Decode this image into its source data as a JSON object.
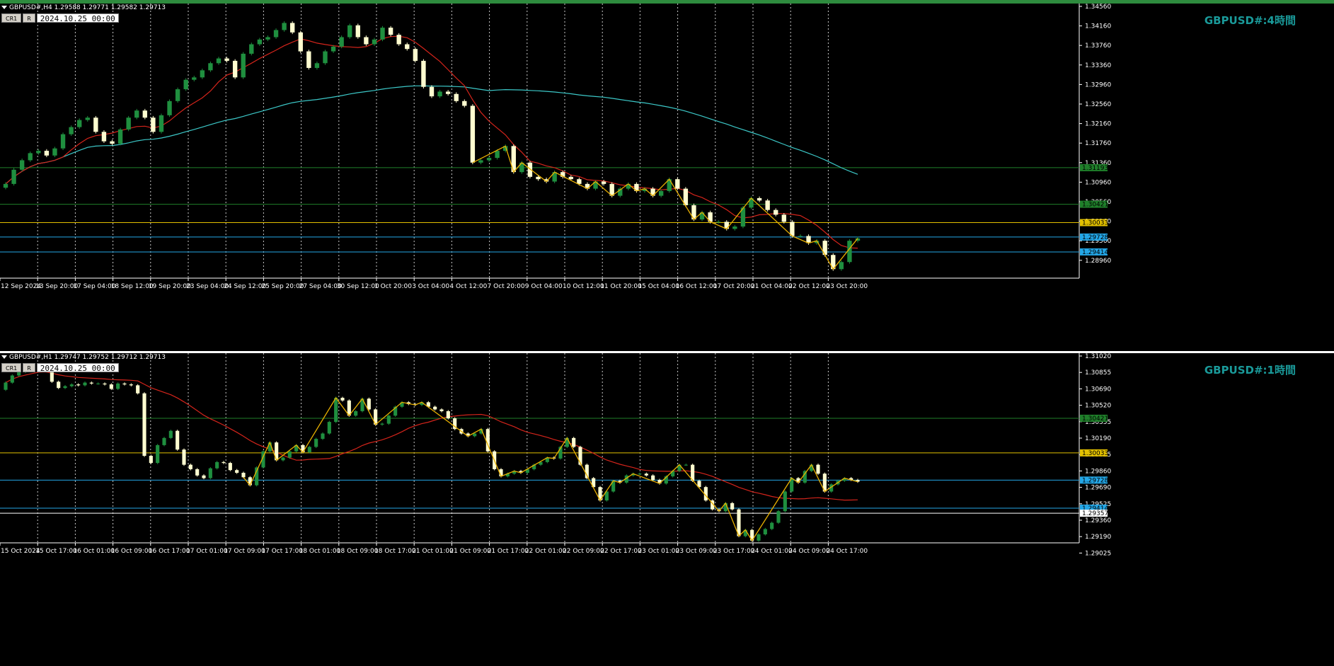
{
  "colors": {
    "background": "#000000",
    "axis": "#ffffff",
    "grid": "#c8c8c8",
    "candle_up": "#1f8f3f",
    "candle_down": "#fffdd0",
    "ma_fast": "#d4241b",
    "ma_slow": "#3cc8c8",
    "zigzag": "#e8b000",
    "line_green": "#1f7f2a",
    "line_yellow": "#e2c000",
    "line_blue": "#23a6e6",
    "symbol_label": "#1a9a9a"
  },
  "panes": [
    {
      "id": "h4",
      "header": "GBPUSD#,H4  1.29588 1.29771 1.29582 1.29713",
      "buttons": [
        "CR1",
        "R"
      ],
      "date_box": "2024.10.25 00:00",
      "symbol_label": "GBPUSD#:4時間",
      "price_ticks": [
        "1.34560",
        "1.34160",
        "1.33760",
        "1.33360",
        "1.32960",
        "1.32560",
        "1.32160",
        "1.31760",
        "1.31360",
        "1.30960",
        "1.30560",
        "1.30160",
        "1.29560",
        "1.28960"
      ],
      "time_ticks": [
        "12 Sep 2024",
        "13 Sep 20:00",
        "17 Sep 04:00",
        "18 Sep 12:00",
        "19 Sep 20:00",
        "23 Sep 04:00",
        "24 Sep 12:00",
        "25 Sep 20:00",
        "27 Sep 04:00",
        "30 Sep 12:00",
        "1 Oct 20:00",
        "3 Oct 04:00",
        "4 Oct 12:00",
        "7 Oct 20:00",
        "9 Oct 04:00",
        "10 Oct 12:00",
        "11 Oct 20:00",
        "15 Oct 04:00",
        "16 Oct 12:00",
        "17 Oct 20:00",
        "21 Oct 04:00",
        "22 Oct 12:00",
        "23 Oct 20:00"
      ],
      "price_labels": [
        {
          "value": "1.31193",
          "color": "#1f7f2a"
        },
        {
          "value": "1.30421",
          "color": "#1f7f2a"
        },
        {
          "value": "1.30033",
          "color": "#e2c000"
        },
        {
          "value": "1.29728",
          "color": "#23a6e6"
        },
        {
          "value": "1.29414",
          "color": "#23a6e6"
        }
      ]
    },
    {
      "id": "h1",
      "header": "GBPUSD#,H1  1.29747 1.29752 1.29712 1.29713",
      "buttons": [
        "CR1",
        "R"
      ],
      "date_box": "2024.10.25 00:00",
      "symbol_label": "GBPUSD#:1時間",
      "price_ticks": [
        "1.31020",
        "1.30855",
        "1.30690",
        "1.30520",
        "1.30355",
        "1.30190",
        "1.30025",
        "1.29860",
        "1.29690",
        "1.29525",
        "1.29360",
        "1.29190",
        "1.29025"
      ],
      "time_ticks": [
        "15 Oct 2024",
        "15 Oct 17:00",
        "16 Oct 01:00",
        "16 Oct 09:00",
        "16 Oct 17:00",
        "17 Oct 01:00",
        "17 Oct 09:00",
        "17 Oct 17:00",
        "18 Oct 01:00",
        "18 Oct 09:00",
        "18 Oct 17:00",
        "21 Oct 01:00",
        "21 Oct 09:00",
        "21 Oct 17:00",
        "22 Oct 01:00",
        "22 Oct 09:00",
        "22 Oct 17:00",
        "23 Oct 01:00",
        "23 Oct 09:00",
        "23 Oct 17:00",
        "24 Oct 01:00",
        "24 Oct 09:00",
        "24 Oct 17:00"
      ],
      "price_labels": [
        {
          "value": "1.30421",
          "color": "#1f7f2a"
        },
        {
          "value": "1.30033",
          "color": "#e2c000"
        },
        {
          "value": "1.29728",
          "color": "#23a6e6"
        },
        {
          "value": "1.29414",
          "color": "#23a6e6"
        },
        {
          "value": "1.29357",
          "color": "#ffffff"
        }
      ]
    }
  ],
  "chart_data": [
    {
      "type": "line",
      "title": "GBPUSD#:4時間",
      "timeframe": "H4",
      "ylim": [
        1.2886,
        1.3466
      ],
      "hlines": [
        1.31193,
        1.30421,
        1.30033,
        1.29728,
        1.29414
      ],
      "series": [
        {
          "values": [
            1.3085,
            1.3115,
            1.3135,
            1.315,
            1.3155,
            1.3145,
            1.316,
            1.319,
            1.3205,
            1.322,
            1.3225,
            1.3195,
            1.3175,
            1.317,
            1.32,
            1.3225,
            1.324,
            1.3225,
            1.3195,
            1.323,
            1.326,
            1.3285,
            1.3305,
            1.331,
            1.3325,
            1.334,
            1.335,
            1.3345,
            1.331,
            1.336,
            1.338,
            1.339,
            1.3395,
            1.341,
            1.3425,
            1.3405,
            1.3365,
            1.333,
            1.334,
            1.3365,
            1.3375,
            1.3395,
            1.342,
            1.3395,
            1.338,
            1.339,
            1.3415,
            1.34,
            1.338,
            1.337,
            1.3345,
            1.329,
            1.327,
            1.328,
            1.3275,
            1.326,
            1.325,
            1.313,
            1.3135,
            1.314,
            1.3155,
            1.3165,
            1.311,
            1.313,
            1.31,
            1.3095,
            1.309,
            1.311,
            1.31,
            1.3095,
            1.3085,
            1.3075,
            1.309,
            1.3085,
            1.306,
            1.3075,
            1.3085,
            1.307,
            1.3075,
            1.306,
            1.307,
            1.3095,
            1.3075,
            1.304,
            1.301,
            1.3025,
            1.3005,
            1.3005,
            1.299,
            1.2995,
            1.3035,
            1.3055,
            1.305,
            1.303,
            1.302,
            1.3005,
            1.2975,
            1.2975,
            1.296,
            1.2965,
            1.2935,
            1.2905,
            1.292,
            1.2965,
            1.297
          ]
        }
      ]
    },
    {
      "type": "line",
      "title": "GBPUSD#:1時間",
      "timeframe": "H1",
      "ylim": [
        1.29025,
        1.3115
      ],
      "hlines": [
        1.30421,
        1.30033,
        1.29728,
        1.29414,
        1.29357
      ],
      "series": [
        {
          "values": [
            1.3082,
            1.309,
            1.3094,
            1.3096,
            1.3099,
            1.3101,
            1.3096,
            1.3083,
            1.3076,
            1.3078,
            1.308,
            1.3079,
            1.3082,
            1.3081,
            1.3081,
            1.308,
            1.3075,
            1.3081,
            1.308,
            1.3079,
            1.307,
            1.3,
            1.2992,
            1.3012,
            1.302,
            1.3028,
            1.3007,
            1.299,
            1.2985,
            1.2978,
            1.2975,
            1.2986,
            1.2993,
            1.2992,
            1.2984,
            1.2981,
            1.2976,
            1.2967,
            1.2987,
            1.3005,
            1.3015,
            1.2995,
            1.2998,
            1.3005,
            1.3012,
            1.3004,
            1.301,
            1.3019,
            1.3025,
            1.3038,
            1.3065,
            1.3062,
            1.3045,
            1.305,
            1.3064,
            1.3052,
            1.3035,
            1.3036,
            1.3045,
            1.3055,
            1.306,
            1.3058,
            1.3057,
            1.306,
            1.3055,
            1.3052,
            1.305,
            1.3042,
            1.303,
            1.3025,
            1.3022,
            1.3025,
            1.303,
            1.3005,
            1.2985,
            1.2977,
            1.298,
            1.2983,
            1.2981,
            1.2985,
            1.299,
            1.2993,
            1.2998,
            1.2997,
            1.301,
            1.302,
            1.301,
            1.299,
            1.2975,
            1.2965,
            1.295,
            1.296,
            1.2972,
            1.297,
            1.2978,
            1.298,
            1.298,
            1.2978,
            1.2973,
            1.2969,
            1.2977,
            1.2983,
            1.299,
            1.299,
            1.2972,
            1.2965,
            1.295,
            1.294,
            1.2938,
            1.2947,
            1.294,
            1.291,
            1.2917,
            1.2905,
            1.2912,
            1.2918,
            1.2925,
            1.2938,
            1.296,
            1.2975,
            1.297,
            1.2983,
            1.299,
            1.298,
            1.296,
            1.2968,
            1.2972,
            1.2975,
            1.2973,
            1.2971
          ]
        }
      ]
    }
  ]
}
